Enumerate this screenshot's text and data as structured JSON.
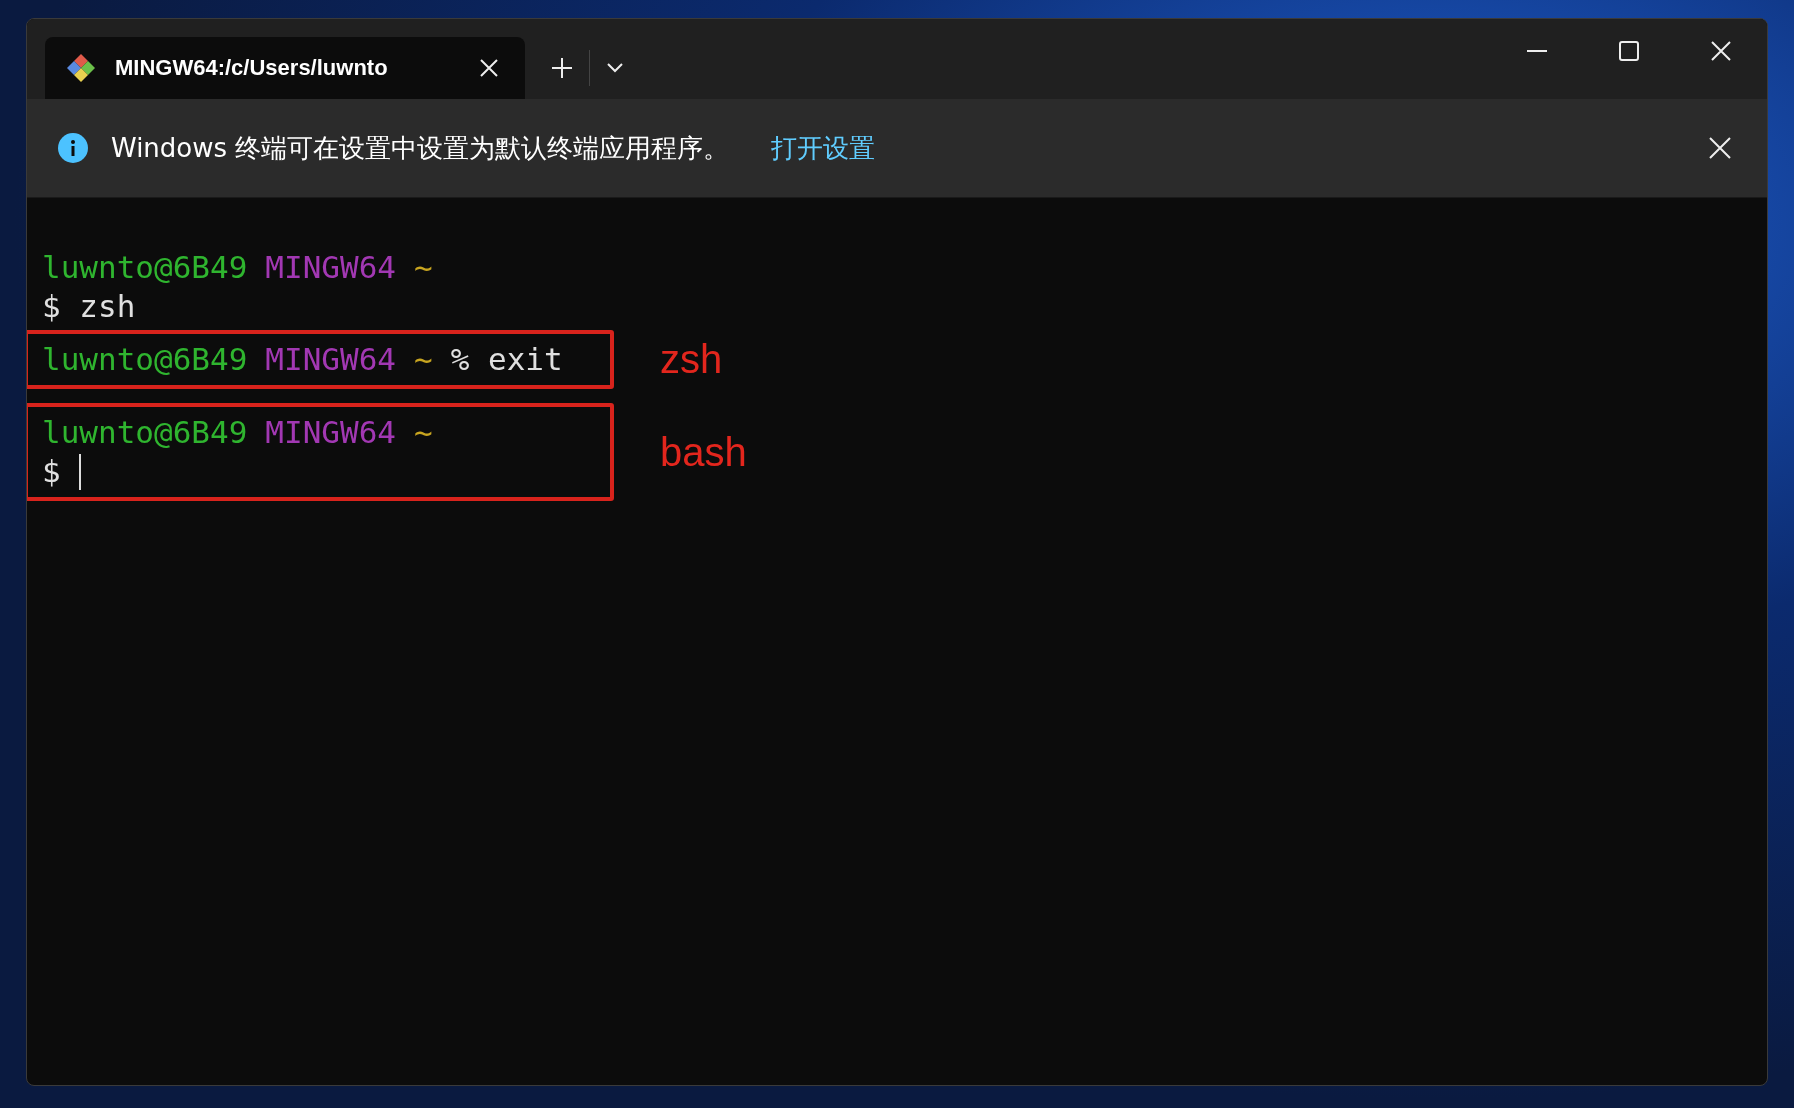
{
  "window": {
    "tab": {
      "title": "MINGW64:/c/Users/luwnto",
      "selected": true
    }
  },
  "infobar": {
    "message": "Windows 终端可在设置中设置为默认终端应用程序。",
    "link": "打开设置"
  },
  "terminal": {
    "blocks": [
      {
        "kind": "plain",
        "lines": [
          {
            "segments": [
              {
                "kind": "user",
                "text": "luwnto@6B49"
              },
              {
                "kind": "host",
                "text": "MINGW64"
              },
              {
                "kind": "path",
                "text": "~"
              }
            ]
          },
          {
            "segments": [
              {
                "kind": "text",
                "text": "$ zsh"
              }
            ]
          }
        ]
      },
      {
        "kind": "annotated",
        "label": "zsh",
        "lines": [
          {
            "segments": [
              {
                "kind": "user",
                "text": "luwnto@6B49"
              },
              {
                "kind": "host",
                "text": "MINGW64"
              },
              {
                "kind": "path",
                "text": "~"
              },
              {
                "kind": "text",
                "text": "% exit"
              }
            ]
          }
        ]
      },
      {
        "kind": "annotated",
        "label": "bash",
        "lines": [
          {
            "segments": [
              {
                "kind": "user",
                "text": "luwnto@6B49"
              },
              {
                "kind": "host",
                "text": "MINGW64"
              },
              {
                "kind": "path",
                "text": "~"
              }
            ]
          },
          {
            "segments": [
              {
                "kind": "text",
                "text": "$"
              }
            ],
            "cursor": true
          }
        ]
      }
    ]
  }
}
